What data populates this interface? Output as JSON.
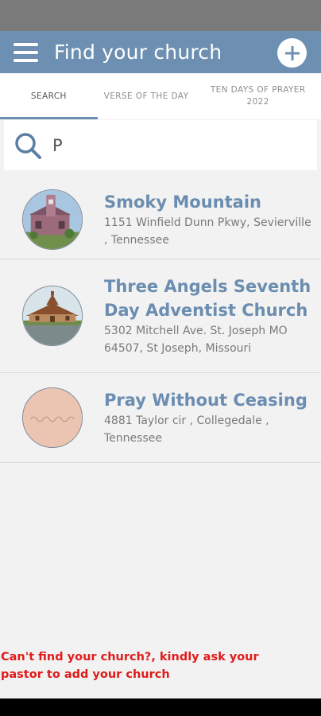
{
  "app_bar": {
    "title": "Find your church",
    "menu_icon": "hamburger-menu-icon",
    "add_icon": "plus-circle-icon"
  },
  "tabs": [
    {
      "label": "SEARCH",
      "active": true
    },
    {
      "label": "VERSE OF THE DAY",
      "active": false
    },
    {
      "label": "TEN DAYS OF PRAYER 2022",
      "active": false
    }
  ],
  "search": {
    "value": "P",
    "icon": "search-icon"
  },
  "churches": [
    {
      "name": "Smoky Mountain",
      "address": "1151 Winfield Dunn Pkwy, Sevierville , Tennessee"
    },
    {
      "name": "Three Angels Seventh Day Adventist Church",
      "address": "5302 Mitchell Ave. St. Joseph MO 64507, St Joseph, Missouri"
    },
    {
      "name": "Pray Without Ceasing",
      "address": "4881 Taylor cir , Collegedale , Tennessee"
    }
  ],
  "footer": {
    "note": "Can't find your church?, kindly ask your pastor to add your church"
  },
  "colors": {
    "primary": "#6d8fb1",
    "church_name": "#6b8db0",
    "warning_text": "#e11b1b",
    "background": "#f2f2f2"
  }
}
